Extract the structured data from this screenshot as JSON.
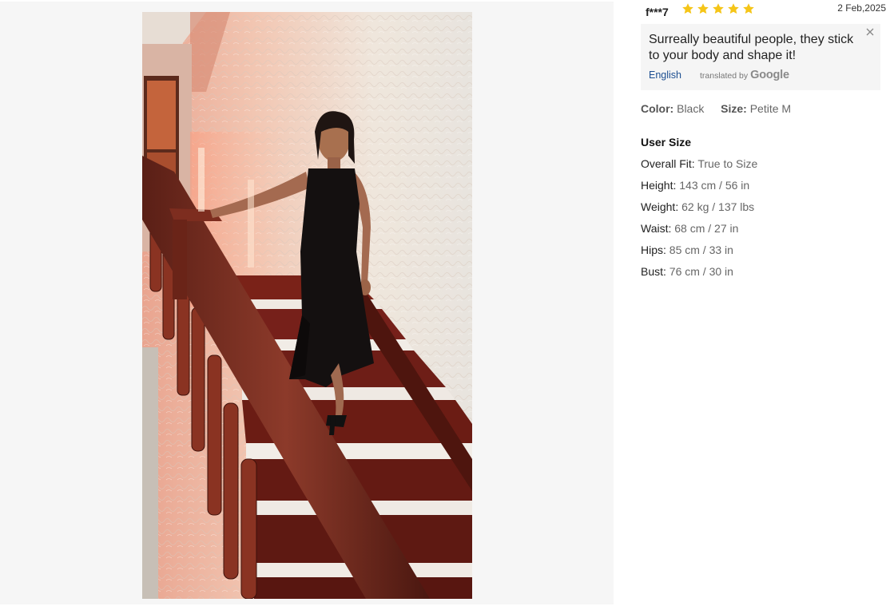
{
  "review": {
    "username": "f***7",
    "rating": 5,
    "date": "2 Feb,2025",
    "star_color": "#f5c518",
    "photo_icon": "review-photo-image"
  },
  "translation": {
    "text": "Surreally beautiful people, they stick to your body and shape it!",
    "language_link": "English",
    "credit_prefix": "translated by",
    "credit_brand": "Google",
    "close_icon": "close-icon"
  },
  "attributes": {
    "color_label": "Color:",
    "color_value": "Black",
    "size_label": "Size:",
    "size_value": "Petite M"
  },
  "user_size": {
    "title": "User Size",
    "rows": [
      {
        "label": "Overall Fit:",
        "value": "True to Size"
      },
      {
        "label": "Height:",
        "value": "143 cm / 56 in"
      },
      {
        "label": "Weight:",
        "value": "62 kg / 137 lbs"
      },
      {
        "label": "Waist:",
        "value": "68 cm / 27 in"
      },
      {
        "label": "Hips:",
        "value": "85 cm / 33 in"
      },
      {
        "label": "Bust:",
        "value": "76 cm / 30 in"
      }
    ]
  }
}
